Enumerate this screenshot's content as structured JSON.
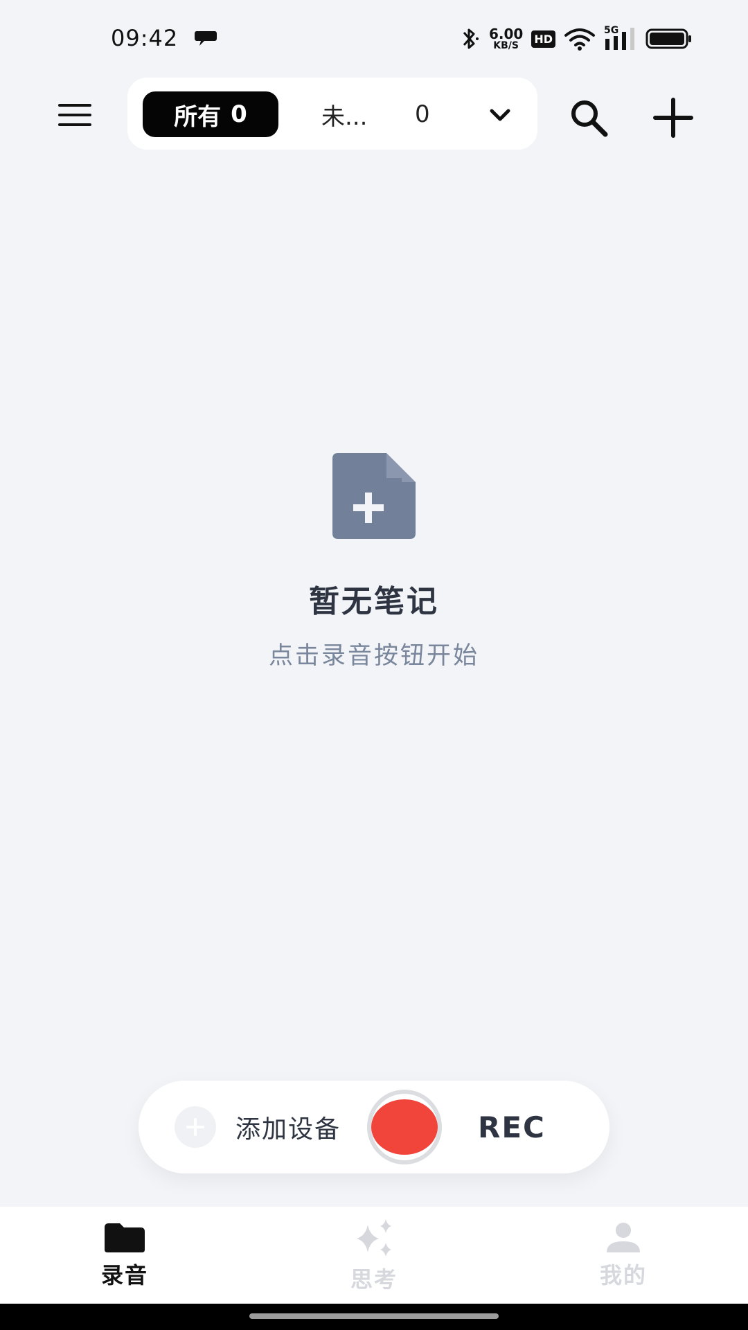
{
  "status_bar": {
    "time": "09:42",
    "network_speed_value": "6.00",
    "network_speed_unit": "KB/S",
    "hd_badge": "HD",
    "signal_label": "5G",
    "icons": [
      "chat-bubble-icon",
      "bluetooth-icon",
      "wifi-icon",
      "signal-icon",
      "battery-icon"
    ]
  },
  "topbar": {
    "icons": [
      "menu-icon",
      "chevron-down-icon",
      "search-icon",
      "plus-icon"
    ],
    "tabs": [
      {
        "label": "所有",
        "count": "0",
        "selected": true
      },
      {
        "label": "未...",
        "count": "0",
        "selected": false
      }
    ]
  },
  "empty_state": {
    "icon": "note-add-icon",
    "title": "暂无笔记",
    "subtitle": "点击录音按钮开始"
  },
  "recorder": {
    "add_device_label": "添加设备",
    "rec_label": "REC",
    "rec_color": "#f1443a"
  },
  "bottom_nav": {
    "items": [
      {
        "label": "录音",
        "icon": "folder-icon",
        "active": true
      },
      {
        "label": "思考",
        "icon": "sparkle-icon",
        "active": false
      },
      {
        "label": "我的",
        "icon": "person-icon",
        "active": false
      }
    ]
  }
}
